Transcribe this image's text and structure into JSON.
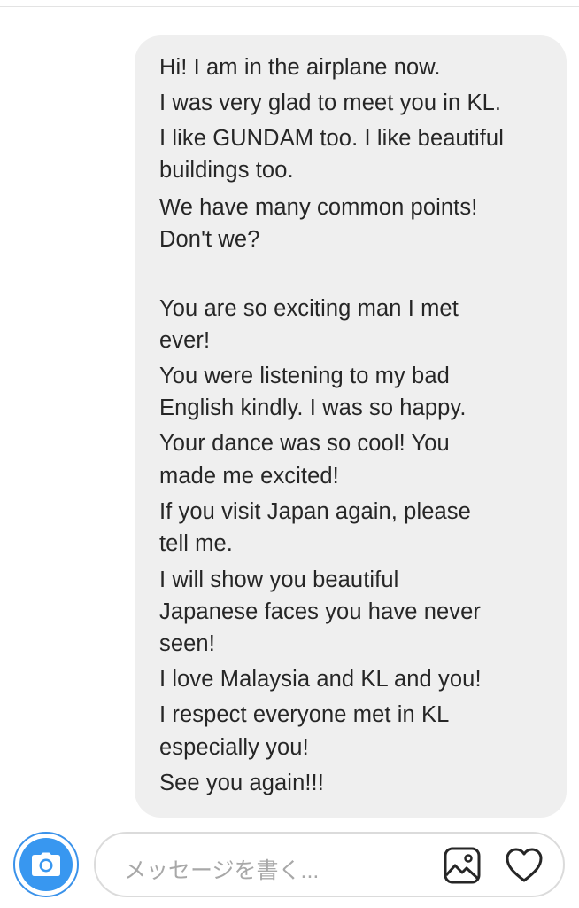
{
  "message": {
    "lines": [
      "Hi! I am in the airplane now.",
      "I was very glad to meet you in KL.",
      "I like GUNDAM too. I like beautiful",
      "buildings too.",
      "We have many common points!",
      "Don't we?",
      "",
      "You are so exciting man I met",
      "ever!",
      "You were listening to my bad",
      "English kindly. I was so happy.",
      "Your dance was so cool! You",
      "made me excited!",
      "If you visit Japan again, please",
      "tell me.",
      "I will show you beautiful",
      "Japanese faces you have never",
      "seen!",
      "I love Malaysia and KL and you!",
      "I respect everyone met in KL",
      "especially you!",
      "See you again!!!"
    ]
  },
  "composer": {
    "placeholder": "メッセージを書く...",
    "camera_icon": "camera-icon",
    "gallery_icon": "image-gallery-icon",
    "heart_icon": "heart-icon"
  },
  "colors": {
    "bubble": "#efefef",
    "text": "#262626",
    "accent": "#3897f0",
    "placeholder": "#a8a8a8"
  }
}
